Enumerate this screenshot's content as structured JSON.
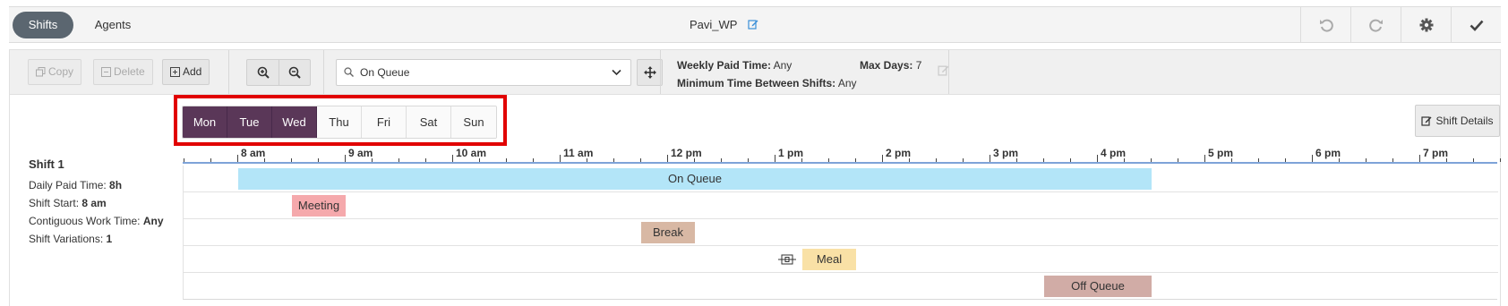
{
  "top_tabs": {
    "shifts": "Shifts",
    "agents": "Agents"
  },
  "work_plan_title": "Pavi_WP",
  "top_actions": [
    "undo-icon",
    "redo-icon",
    "gear-icon",
    "check-icon"
  ],
  "toolbar": {
    "copy": "Copy",
    "delete": "Delete",
    "add": "Add",
    "activity_select": {
      "value": "On Queue"
    },
    "weekly_paid_time_label": "Weekly Paid Time:",
    "weekly_paid_time_value": "Any",
    "max_days_label": "Max Days:",
    "max_days_value": "7",
    "min_time_label": "Minimum Time Between Shifts:",
    "min_time_value": "Any"
  },
  "days": [
    {
      "label": "Mon",
      "active": true
    },
    {
      "label": "Tue",
      "active": true
    },
    {
      "label": "Wed",
      "active": true
    },
    {
      "label": "Thu",
      "active": false
    },
    {
      "label": "Fri",
      "active": false
    },
    {
      "label": "Sat",
      "active": false
    },
    {
      "label": "Sun",
      "active": false
    }
  ],
  "shift_details_button": "Shift Details",
  "shift": {
    "name": "Shift 1",
    "daily_paid_time_label": "Daily Paid Time:",
    "daily_paid_time_value": "8h",
    "shift_start_label": "Shift Start:",
    "shift_start_value": "8 am",
    "contiguous_label": "Contiguous Work Time:",
    "contiguous_value": "Any",
    "variations_label": "Shift Variations:",
    "variations_value": "1"
  },
  "timeline": {
    "hours": [
      "8 am",
      "9 am",
      "10 am",
      "11 am",
      "12 pm",
      "1 pm",
      "2 pm",
      "3 pm",
      "4 pm",
      "5 pm",
      "6 pm",
      "7 pm"
    ],
    "activities": [
      {
        "label": "On Queue",
        "color": "#b3e5f8"
      },
      {
        "label": "Meeting",
        "color": "#f5a9ac"
      },
      {
        "label": "Break",
        "color": "#d8b8a4"
      },
      {
        "label": "Meal",
        "color": "#f9e1a6"
      },
      {
        "label": "Off Queue",
        "color": "#d1aca6"
      }
    ]
  },
  "colors": {
    "day_active": "#5a3758",
    "highlight": "#e10000",
    "tab_active": "#5b6670"
  }
}
